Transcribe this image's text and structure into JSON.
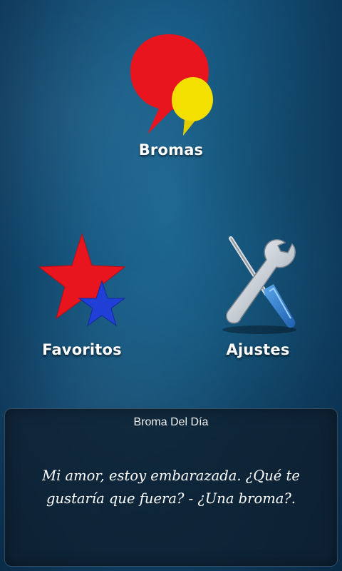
{
  "menu": {
    "bromas": {
      "label": "Bromas",
      "icon": "speech-bubbles-icon"
    },
    "favoritos": {
      "label": "Favoritos",
      "icon": "stars-icon"
    },
    "ajustes": {
      "label": "Ajustes",
      "icon": "tools-icon"
    }
  },
  "joke_of_day": {
    "title": "Broma Del Día",
    "text": "Mi amor, estoy embarazada. ¿Qué te gustaría que fuera? - ¿Una broma?."
  },
  "colors": {
    "background": "#175a83",
    "bubble_red": "#e8141e",
    "bubble_yellow": "#f3e000",
    "star_red": "#e8141e",
    "star_blue": "#1f3fd6",
    "wrench_handle": "#2f7fd0"
  }
}
